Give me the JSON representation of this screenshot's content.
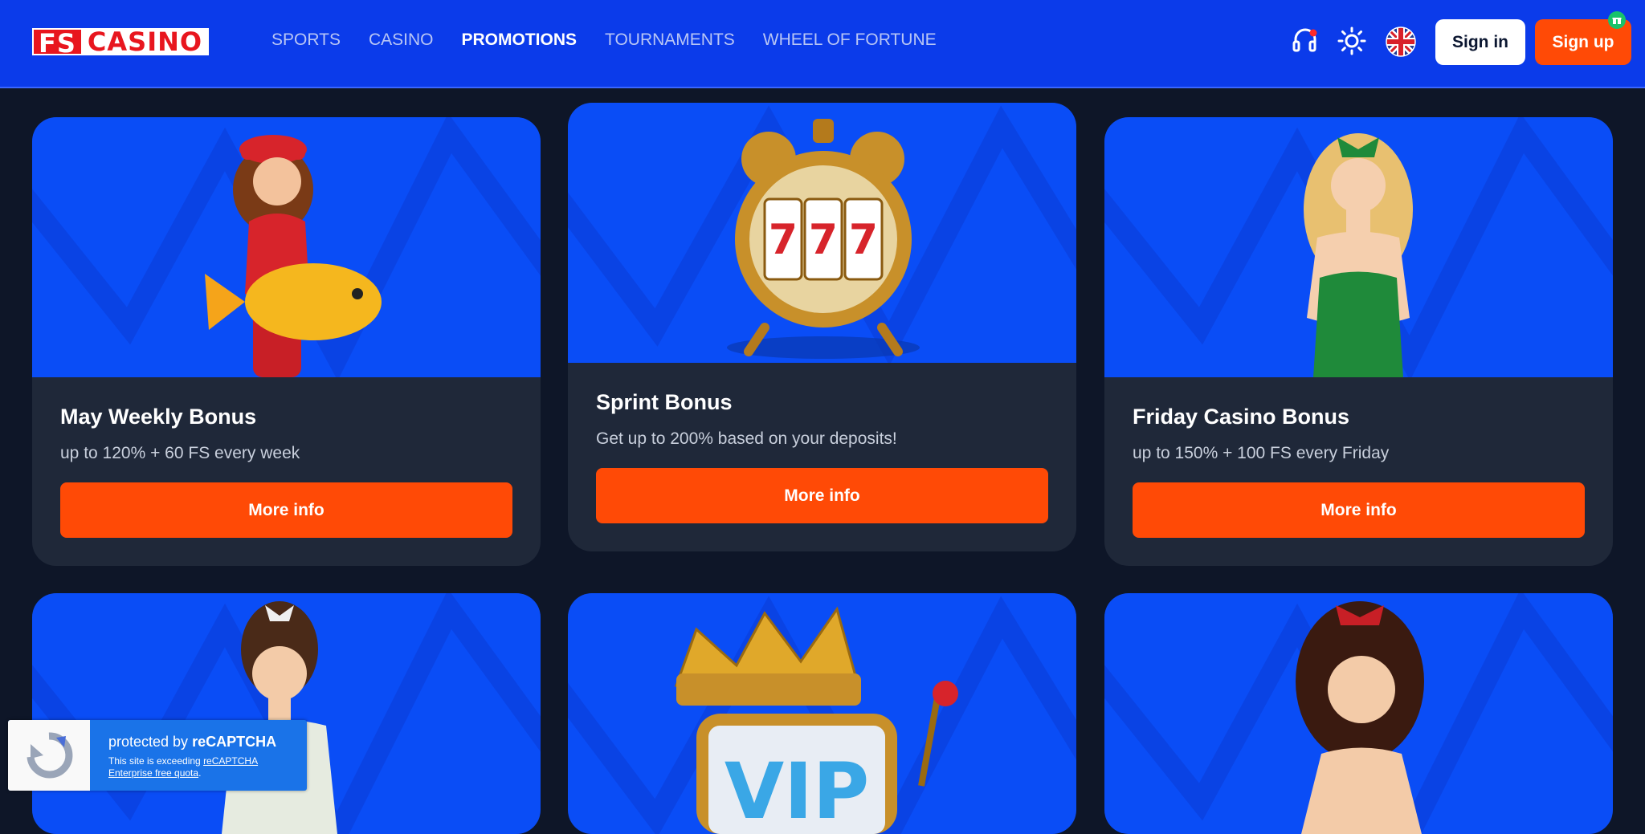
{
  "header": {
    "logo": {
      "part1": "FS",
      "part2": "CASINO"
    },
    "nav": [
      {
        "label": "SPORTS",
        "active": false
      },
      {
        "label": "CASINO",
        "active": false
      },
      {
        "label": "PROMOTIONS",
        "active": true
      },
      {
        "label": "TOURNAMENTS",
        "active": false
      },
      {
        "label": "WHEEL OF FORTUNE",
        "active": false
      }
    ],
    "icons": [
      "support-icon",
      "theme-sun-icon",
      "uk-flag-icon"
    ],
    "signin_label": "Sign in",
    "signup_label": "Sign up"
  },
  "promotions": [
    {
      "title": "May Weekly Bonus",
      "subtitle": "up to 120% + 60 FS every week",
      "button": "More info",
      "art": "woman-with-golden-fish"
    },
    {
      "title": "Sprint Bonus",
      "subtitle": "Get up to 200% based on your deposits!",
      "button": "More info",
      "art": "slot-alarm-clock"
    },
    {
      "title": "Friday Casino Bonus",
      "subtitle": "up to 150% + 100 FS every Friday",
      "button": "More info",
      "art": "woman-in-green-dress"
    },
    {
      "art": "woman-with-hair-bow"
    },
    {
      "art": "vip-crown-slot"
    },
    {
      "art": "woman-with-red-bow"
    }
  ],
  "recaptcha": {
    "title_prefix": "protected by ",
    "title_bold": "reCAPTCHA",
    "notice_prefix": "This site is exceeding ",
    "notice_link": "reCAPTCHA Enterprise free quota",
    "notice_suffix": "."
  },
  "colors": {
    "header_bg": "#0b3bea",
    "page_bg": "#0e1628",
    "card_bg": "#1f2839",
    "accent": "#ff4a06",
    "art_bg": "#0a4df6"
  }
}
